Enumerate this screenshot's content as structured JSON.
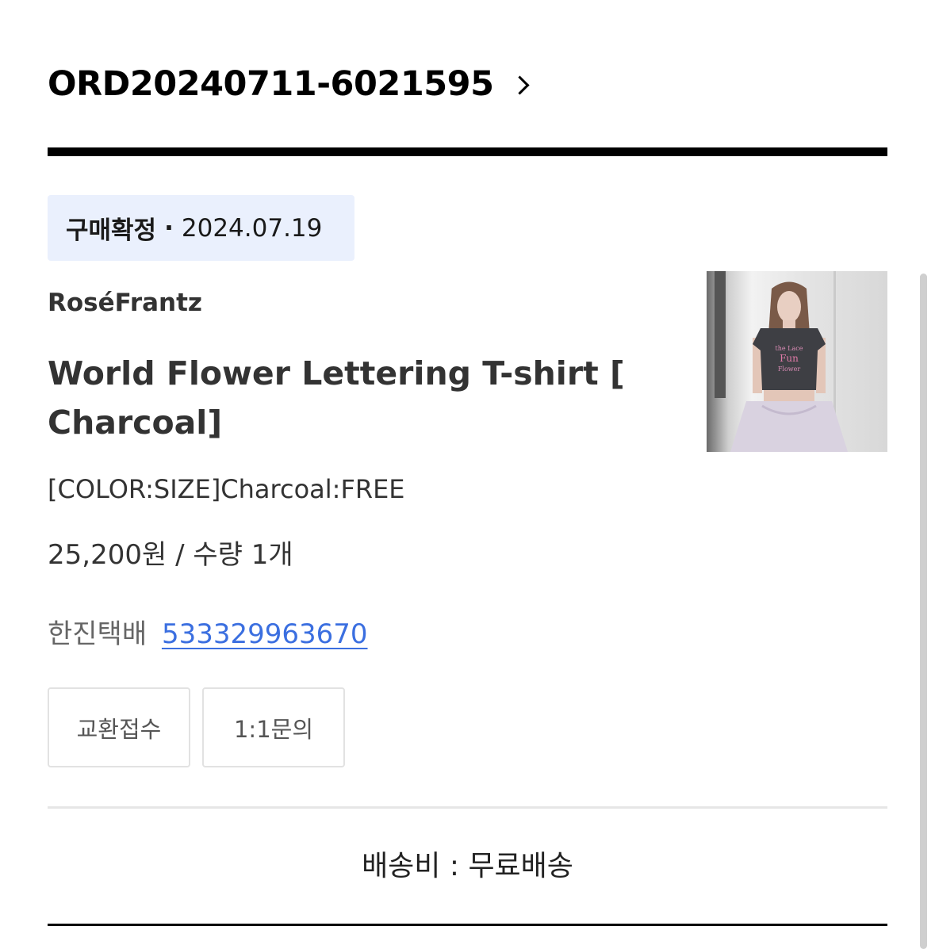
{
  "order": {
    "number": "ORD20240711-6021595"
  },
  "status": {
    "label": "구매확정",
    "separator": "·",
    "date": "2024.07.19"
  },
  "product": {
    "brand": "RoséFrantz",
    "name": "World Flower Lettering T-shirt [ Charcoal]",
    "option": "[COLOR:SIZE]Charcoal:FREE",
    "price": "25,200원",
    "quantity_text": "/ 수량 1개"
  },
  "shipping": {
    "carrier": "한진택배",
    "tracking_number": "533329963670"
  },
  "actions": {
    "exchange_label": "교환접수",
    "inquiry_label": "1:1문의"
  },
  "delivery_fee": {
    "text": "배송비 : 무료배송"
  },
  "colors": {
    "badge_bg": "#eaf0fd",
    "link": "#3b6fe0",
    "rule": "#000000"
  }
}
